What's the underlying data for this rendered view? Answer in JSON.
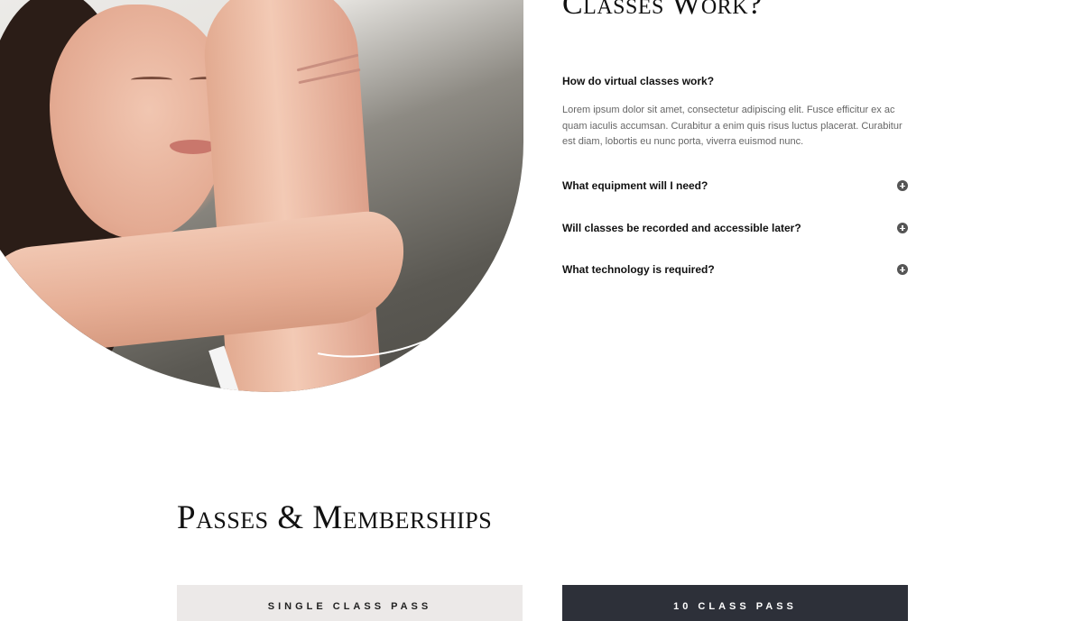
{
  "faq": {
    "title": "Classes Work?",
    "open_question": "How do virtual classes work?",
    "open_answer": "Lorem ipsum dolor sit amet, consectetur adipiscing elit. Fusce efficitur ex ac quam iaculis accumsan. Curabitur a enim quis risus luctus placerat. Curabitur est diam, lobortis eu nunc porta, viverra euismod nunc.",
    "items": [
      {
        "label": "What equipment will I need?",
        "icon": "plus-circle-icon"
      },
      {
        "label": "Will classes be recorded and accessible later?",
        "icon": "plus-circle-icon"
      },
      {
        "label": "What technology is required?",
        "icon": "plus-circle-icon"
      }
    ]
  },
  "passes": {
    "title": "Passes & Memberships",
    "cards": [
      {
        "label": "Single Class Pass"
      },
      {
        "label": "10 Class Pass"
      }
    ]
  },
  "colors": {
    "dark_card": "#2d3039",
    "light_card": "#ece9e8",
    "icon": "#555555"
  }
}
